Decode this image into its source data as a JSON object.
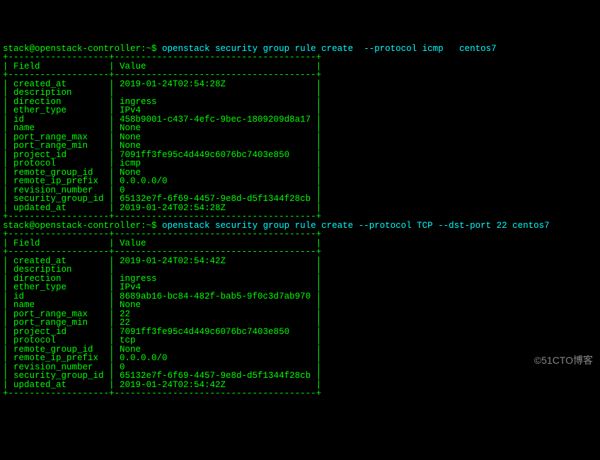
{
  "prompt1": {
    "user": "stack@openstack-controller:~$ ",
    "command": "openstack security group rule create  --protocol icmp   centos7"
  },
  "table1": {
    "header": {
      "field": "Field",
      "value": "Value"
    },
    "rows": [
      {
        "field": "created_at",
        "value": "2019-01-24T02:54:28Z"
      },
      {
        "field": "description",
        "value": ""
      },
      {
        "field": "direction",
        "value": "ingress"
      },
      {
        "field": "ether_type",
        "value": "IPv4"
      },
      {
        "field": "id",
        "value": "458b9001-c437-4efc-9bec-1809209d8a17"
      },
      {
        "field": "name",
        "value": "None"
      },
      {
        "field": "port_range_max",
        "value": "None"
      },
      {
        "field": "port_range_min",
        "value": "None"
      },
      {
        "field": "project_id",
        "value": "7091ff3fe95c4d449c6076bc7403e850"
      },
      {
        "field": "protocol",
        "value": "icmp"
      },
      {
        "field": "remote_group_id",
        "value": "None"
      },
      {
        "field": "remote_ip_prefix",
        "value": "0.0.0.0/0"
      },
      {
        "field": "revision_number",
        "value": "0"
      },
      {
        "field": "security_group_id",
        "value": "65132e7f-6f69-4457-9e8d-d5f1344f28cb"
      },
      {
        "field": "updated_at",
        "value": "2019-01-24T02:54:28Z"
      }
    ]
  },
  "prompt2": {
    "user": "stack@openstack-controller:~$ ",
    "command": "openstack security group rule create --protocol TCP --dst-port 22 centos7"
  },
  "table2": {
    "header": {
      "field": "Field",
      "value": "Value"
    },
    "rows": [
      {
        "field": "created_at",
        "value": "2019-01-24T02:54:42Z"
      },
      {
        "field": "description",
        "value": ""
      },
      {
        "field": "direction",
        "value": "ingress"
      },
      {
        "field": "ether_type",
        "value": "IPv4"
      },
      {
        "field": "id",
        "value": "8689ab16-bc84-482f-bab5-9f0c3d7ab970"
      },
      {
        "field": "name",
        "value": "None"
      },
      {
        "field": "port_range_max",
        "value": "22"
      },
      {
        "field": "port_range_min",
        "value": "22"
      },
      {
        "field": "project_id",
        "value": "7091ff3fe95c4d449c6076bc7403e850"
      },
      {
        "field": "protocol",
        "value": "tcp"
      },
      {
        "field": "remote_group_id",
        "value": "None"
      },
      {
        "field": "remote_ip_prefix",
        "value": "0.0.0.0/0"
      },
      {
        "field": "revision_number",
        "value": "0"
      },
      {
        "field": "security_group_id",
        "value": "65132e7f-6f69-4457-9e8d-d5f1344f28cb"
      },
      {
        "field": "updated_at",
        "value": "2019-01-24T02:54:42Z"
      }
    ]
  },
  "watermark": "©51CTO博客",
  "layout": {
    "border": "+-------------------+--------------------------------------+",
    "col1_width": 19,
    "col2_width": 38
  }
}
